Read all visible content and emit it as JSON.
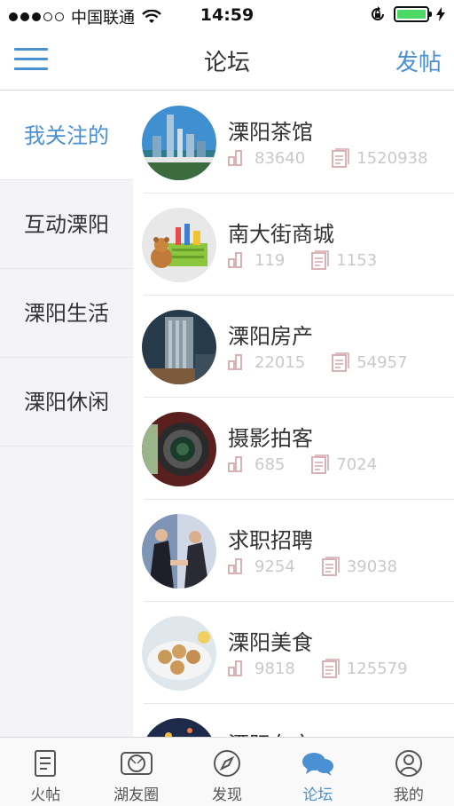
{
  "status_bar": {
    "carrier": "中国联通",
    "time": "14:59"
  },
  "nav": {
    "title": "论坛",
    "post_label": "发帖"
  },
  "sidebar": {
    "items": [
      {
        "label": "我关注的"
      },
      {
        "label": "互动溧阳"
      },
      {
        "label": "溧阳生活"
      },
      {
        "label": "溧阳休闲"
      }
    ]
  },
  "forums": [
    {
      "name": "溧阳茶馆",
      "threads": "83640",
      "posts": "1520938"
    },
    {
      "name": "南大街商城",
      "threads": "119",
      "posts": "1153"
    },
    {
      "name": "溧阳房产",
      "threads": "22015",
      "posts": "54957"
    },
    {
      "name": "摄影拍客",
      "threads": "685",
      "posts": "7024"
    },
    {
      "name": "求职招聘",
      "threads": "9254",
      "posts": "39038"
    },
    {
      "name": "溧阳美食",
      "threads": "9818",
      "posts": "125579"
    },
    {
      "name": "溧阳车市",
      "threads": "",
      "posts": ""
    }
  ],
  "tabbar": {
    "tabs": [
      {
        "label": "火帖",
        "icon": "document-icon"
      },
      {
        "label": "湖友圈",
        "icon": "camera-lens-icon"
      },
      {
        "label": "发现",
        "icon": "compass-icon"
      },
      {
        "label": "论坛",
        "icon": "chat-bubbles-icon"
      },
      {
        "label": "我的",
        "icon": "user-icon"
      }
    ]
  },
  "colors": {
    "accent": "#4a90d2",
    "battery": "#4cd964",
    "sidebar_bg": "#f4f4f8",
    "stat_gray": "#c9c9c9"
  }
}
